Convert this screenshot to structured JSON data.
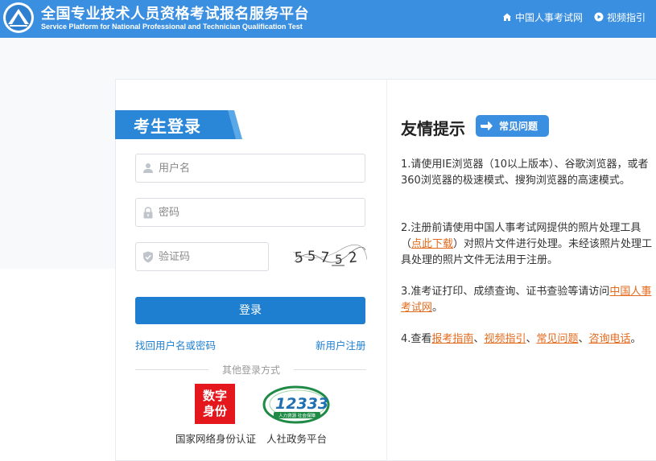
{
  "header": {
    "title_cn": "全国专业技术人员资格考试报名服务平台",
    "title_en": "Service Platform for National Professional and Technician Qualification Test",
    "nav": [
      {
        "label": "中国人事考试网",
        "icon": "home-icon"
      },
      {
        "label": "视频指引",
        "icon": "play-circle-icon"
      }
    ]
  },
  "login": {
    "title": "考生登录",
    "username_placeholder": "用户名",
    "password_placeholder": "密码",
    "captcha_placeholder": "验证码",
    "captcha_chars": [
      "5",
      "5",
      "7",
      "5",
      "2"
    ],
    "login_button": "登录",
    "forgot_link": "找回用户名或密码",
    "register_link": "新用户注册",
    "other_methods": "其他登录方式",
    "providers": [
      {
        "label": "国家网络身份认证",
        "logo_text": [
          "数字",
          "身份"
        ],
        "color": "#e4181c"
      },
      {
        "label": "人社政务平台",
        "logo_text": [
          "12333",
          "人力资源 社会保障"
        ],
        "color": "#1f8a46"
      }
    ]
  },
  "tips": {
    "title": "友情提示",
    "faq_badge": "常见问题",
    "items": [
      {
        "parts": [
          {
            "text": "1.请使用IE浏览器（10以上版本）、谷歌浏览器，或者360浏览器的极速模式、搜狗浏览器的高速模式。"
          }
        ]
      },
      {
        "parts": [
          {
            "text": "2.注册前请使用中国人事考试网提供的照片处理工具（"
          },
          {
            "text": "点此下载",
            "link": true
          },
          {
            "text": "）对照片文件进行处理。未经该照片处理工具处理的照片文件无法用于注册。"
          }
        ]
      },
      {
        "parts": [
          {
            "text": "3.准考证打印、成绩查询、证书查验等请访问"
          },
          {
            "text": "中国人事考试网",
            "link": true
          },
          {
            "text": "。"
          }
        ]
      },
      {
        "parts": [
          {
            "text": "4.查看"
          },
          {
            "text": "报考指南",
            "link": true
          },
          {
            "text": "、"
          },
          {
            "text": "视频指引",
            "link": true
          },
          {
            "text": "、"
          },
          {
            "text": "常见问题",
            "link": true
          },
          {
            "text": "、"
          },
          {
            "text": "咨询电话",
            "link": true
          },
          {
            "text": "。"
          }
        ]
      }
    ]
  },
  "colors": {
    "header": "#3b8fe0",
    "primary": "#1e7fd0",
    "link_orange": "#e36a1c",
    "ribbon": "#2a86d6"
  }
}
